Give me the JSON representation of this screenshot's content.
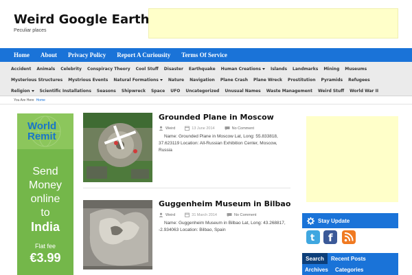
{
  "site": {
    "title": "Weird Google Earth",
    "tagline": "Peculiar places"
  },
  "main_nav": [
    "Home",
    "About",
    "Privacy Policy",
    "Report A Curiousity",
    "Terms Of Service"
  ],
  "categories": {
    "row1": [
      {
        "label": "Accident"
      },
      {
        "label": "Animals"
      },
      {
        "label": "Celebrity"
      },
      {
        "label": "Conspiracy Theory"
      },
      {
        "label": "Cool Stuff"
      },
      {
        "label": "Disaster"
      },
      {
        "label": "Earthquake"
      },
      {
        "label": "Human Creations",
        "has_submenu": true
      },
      {
        "label": "Islands"
      },
      {
        "label": "Landmarks"
      },
      {
        "label": "Mining"
      },
      {
        "label": "Museums"
      }
    ],
    "row2": [
      {
        "label": "Mysterious Structures"
      },
      {
        "label": "Mystrious Events"
      },
      {
        "label": "Natural Formations",
        "has_submenu": true
      },
      {
        "label": "Nature"
      },
      {
        "label": "Navigation"
      },
      {
        "label": "Plane Crash"
      },
      {
        "label": "Plane Wreck"
      },
      {
        "label": "Prostitution"
      },
      {
        "label": "Pyramids"
      },
      {
        "label": "Refugees"
      }
    ],
    "row3": [
      {
        "label": "Religion",
        "has_submenu": true
      },
      {
        "label": "Scientific Installations"
      },
      {
        "label": "Seasons"
      },
      {
        "label": "Shipwreck"
      },
      {
        "label": "Space"
      },
      {
        "label": "UFO"
      },
      {
        "label": "Uncategorized"
      },
      {
        "label": "Unusual Names"
      },
      {
        "label": "Waste Management"
      },
      {
        "label": "Weird Stuff"
      },
      {
        "label": "World War II"
      }
    ]
  },
  "breadcrumb": {
    "prefix": "You Are Here",
    "current": "Home"
  },
  "left_ad": {
    "brand_line1": "World",
    "brand_line2": "Remit",
    "line1": "Send",
    "line2": "Money",
    "line3": "online",
    "line4": "to",
    "destination": "India",
    "fee_label": "Flat fee",
    "price": "€3.99"
  },
  "posts": [
    {
      "title": "Grounded Plane in Moscow",
      "author": "Weird",
      "date": "13 June 2014",
      "comments": "No Comment",
      "excerpt": "Name: Grounded Plane in Moscow Lat, Long: 55.833818, 37.623119 Location: All-Russian Exhibition Center, Moscow, Russia"
    },
    {
      "title": "Guggenheim Museum in Bilbao",
      "author": "Weird",
      "date": "31 March 2014",
      "comments": "No Comment",
      "excerpt": "Name: Guggenheim Museum in Bilbao Lat, Long: 43.268817, -2.934063 Location: Bilbao, Spain"
    }
  ],
  "sidebar": {
    "stay_title": "Stay Update",
    "social_icons": [
      "twitter-icon",
      "facebook-icon",
      "rss-icon"
    ],
    "tabs": [
      "Search",
      "Recent Posts",
      "Archives",
      "Categories"
    ]
  },
  "colors": {
    "nav_blue": "#1a73d8",
    "ad_yellow": "#ffffc9",
    "category_bar": "#ebebeb",
    "ad_green": "#74b74a"
  }
}
